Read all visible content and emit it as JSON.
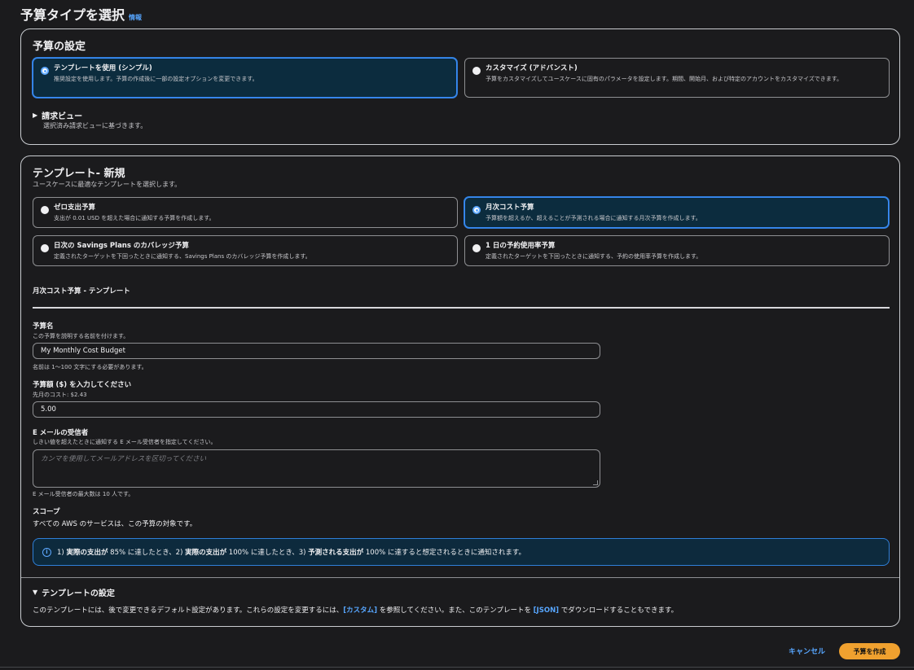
{
  "page": {
    "title": "予算タイプを選択",
    "info_link": "情報"
  },
  "budget_setup": {
    "heading": "予算の設定",
    "options": [
      {
        "title": "テンプレートを使用 (シンプル)",
        "description": "推奨設定を使用します。予算の作成後に一部の設定オプションを変更できます。",
        "selected": true
      },
      {
        "title": "カスタマイズ (アドバンスト)",
        "description": "予算をカスタマイズしてユースケースに固有のパラメータを設定します。期間、開始月、および特定のアカウントをカスタマイズできます。",
        "selected": false
      }
    ],
    "billing_view": {
      "title": "請求ビュー",
      "description": "選択済み請求ビューに基づきます。"
    }
  },
  "templates": {
    "heading": "テンプレート- 新規",
    "subheading": "ユースケースに最適なテンプレートを選択します。",
    "options": [
      {
        "title": "ゼロ支出予算",
        "description": "支出が 0.01 USD を超えた場合に通知する予算を作成します。",
        "selected": false
      },
      {
        "title": "月次コスト予算",
        "description": "予算額を超えるか、超えることが予測される場合に通知する月次予算を作成します。",
        "selected": true
      },
      {
        "title": "日次の Savings Plans のカバレッジ予算",
        "description": "定義されたターゲットを下回ったときに通知する、Savings Plans のカバレッジ予算を作成します。",
        "selected": false
      },
      {
        "title": "1 日の予約使用率予算",
        "description": "定義されたターゲットを下回ったときに通知する、予約の使用率予算を作成します。",
        "selected": false
      }
    ],
    "section_title": "月次コスト予算 - テンプレート"
  },
  "form": {
    "budget_name": {
      "label": "予算名",
      "hint": "この予算を説明する名前を付けます。",
      "value": "My Monthly Cost Budget",
      "constraint": "名前は 1〜100 文字にする必要があります。"
    },
    "budget_amount": {
      "label": "予算額 ($) を入力してください",
      "hint": "先月のコスト: $2.43",
      "value": "5.00"
    },
    "email_recipients": {
      "label": "E メールの受信者",
      "hint": "しきい値を超えたときに通知する E メール受信者を指定してください。",
      "placeholder": "カンマを使用してメールアドレスを区切ってください",
      "constraint": "E メール受信者の最大数は 10 人です。"
    },
    "scope": {
      "label": "スコープ",
      "text": "すべての AWS のサービスは、この予算の対象です。"
    },
    "alert": {
      "part1": "1) ",
      "bold1": "実際の支出が",
      "part2": " 85% に達したとき、2) ",
      "bold2": "実際の支出が",
      "part3": " 100% に達したとき、3) ",
      "bold3": "予測される支出が",
      "part4": " 100% に達すると想定されるときに通知されます。"
    }
  },
  "template_settings": {
    "title": "テンプレートの設定",
    "text1": "このテンプレートには、後で変更できるデフォルト設定があります。これらの設定を変更するには、",
    "link_custom": "[カスタム]",
    "text2": " を参照してください。また、このテンプレートを ",
    "link_json": "[JSON]",
    "text3": " でダウンロードすることもできます。"
  },
  "actions": {
    "cancel": "キャンセル",
    "create": "予算を作成"
  },
  "colors": {
    "accent": "#57a6ff",
    "primary_button": "#f0a12f",
    "selected_tile_bg": "#0c2c3e"
  }
}
